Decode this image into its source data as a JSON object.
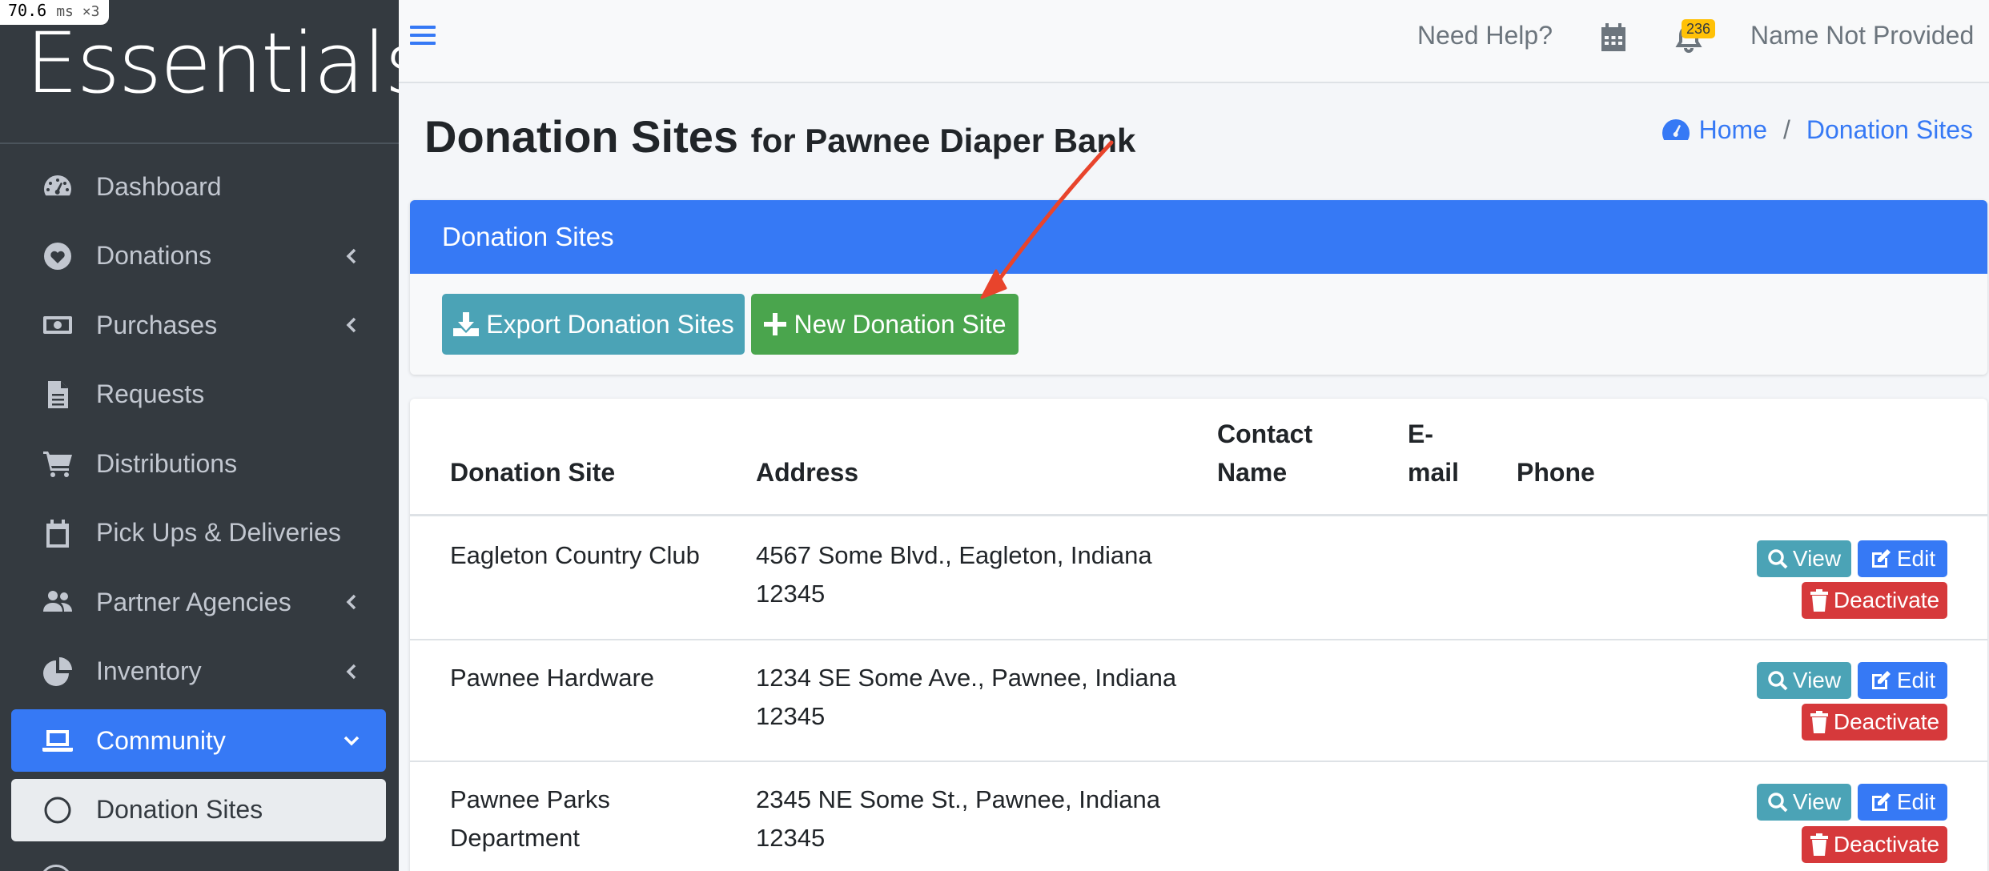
{
  "perf": {
    "value": "70.6",
    "unit": "ms ×3"
  },
  "brand": "Essentials",
  "sidebar": {
    "items": [
      {
        "label": "Dashboard"
      },
      {
        "label": "Donations"
      },
      {
        "label": "Purchases"
      },
      {
        "label": "Requests"
      },
      {
        "label": "Distributions"
      },
      {
        "label": "Pick Ups & Deliveries"
      },
      {
        "label": "Partner Agencies"
      },
      {
        "label": "Inventory"
      },
      {
        "label": "Community"
      },
      {
        "label": "Donation Sites"
      }
    ]
  },
  "topbar": {
    "help": "Need Help?",
    "notifications_count": "236",
    "user": "Name Not Provided"
  },
  "page": {
    "title": "Donation Sites",
    "subtitle": "for Pawnee Diaper Bank"
  },
  "breadcrumb": {
    "home": "Home",
    "current": "Donation Sites",
    "separator": "/"
  },
  "card": {
    "header": "Donation Sites",
    "export_label": "Export Donation Sites",
    "new_label": "New Donation Site"
  },
  "table": {
    "headers": {
      "site": "Donation Site",
      "address": "Address",
      "contact_1": "Contact",
      "contact_2": "Name",
      "email_1": "E-",
      "email_2": "mail",
      "phone": "Phone"
    },
    "actions": {
      "view": "View",
      "edit": "Edit",
      "deactivate": "Deactivate"
    },
    "rows": [
      {
        "site_1": "Eagleton Country Club",
        "site_2": "",
        "address_1": "4567 Some Blvd., Eagleton, Indiana",
        "address_2": "12345"
      },
      {
        "site_1": "Pawnee Hardware",
        "site_2": "",
        "address_1": "1234 SE Some Ave., Pawnee, Indiana",
        "address_2": "12345"
      },
      {
        "site_1": "Pawnee Parks",
        "site_2": "Department",
        "address_1": "2345 NE Some St., Pawnee, Indiana",
        "address_2": "12345"
      }
    ]
  },
  "colors": {
    "sidebar": "#343a40",
    "primary": "#3679f5",
    "info": "#4ba3b6",
    "success": "#4aa54d",
    "danger": "#d6393b",
    "warning": "#ffc107",
    "annotation": "#e8442c"
  }
}
